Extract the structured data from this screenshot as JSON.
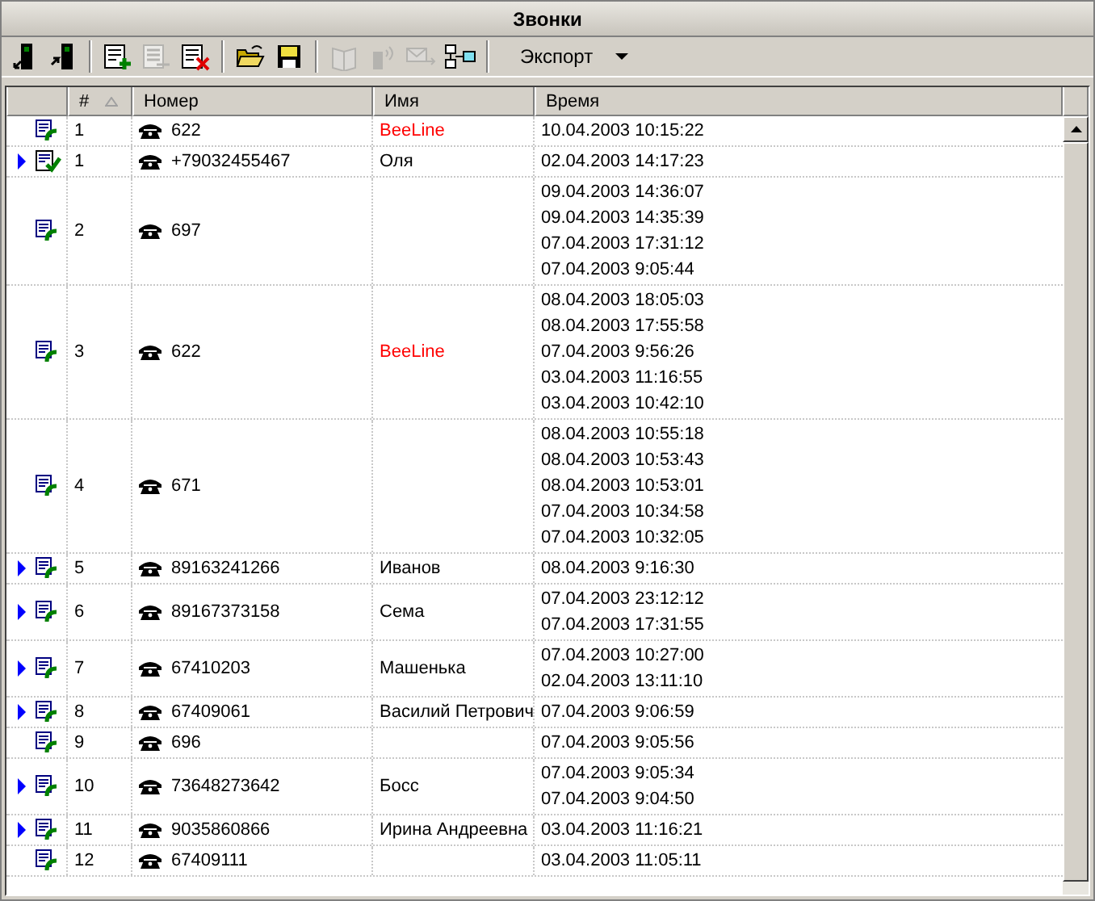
{
  "window": {
    "title": "Звонки"
  },
  "toolbar": [
    {
      "kind": "phone-in",
      "disabled": false
    },
    {
      "kind": "phone-out",
      "disabled": false
    },
    {
      "kind": "sep"
    },
    {
      "kind": "add",
      "disabled": false
    },
    {
      "kind": "edit",
      "disabled": true
    },
    {
      "kind": "delete",
      "disabled": false
    },
    {
      "kind": "sep"
    },
    {
      "kind": "open",
      "disabled": false
    },
    {
      "kind": "save",
      "disabled": false
    },
    {
      "kind": "sep"
    },
    {
      "kind": "book",
      "disabled": true
    },
    {
      "kind": "signal",
      "disabled": true
    },
    {
      "kind": "sms",
      "disabled": true
    },
    {
      "kind": "network",
      "disabled": false
    },
    {
      "kind": "sep"
    },
    {
      "kind": "dropdown",
      "label": "Экспорт"
    }
  ],
  "table": {
    "columns": [
      {
        "label": "#",
        "sort_ascending": true
      },
      {
        "label": "Номер"
      },
      {
        "label": "Имя"
      },
      {
        "label": "Время"
      }
    ],
    "rows": [
      {
        "arrow": false,
        "kind": "call",
        "num": "1",
        "phone": "622",
        "name": "BeeLine",
        "color": "#ff0000",
        "times": [
          "10.04.2003 10:15:22"
        ]
      },
      {
        "arrow": true,
        "kind": "checked",
        "num": "1",
        "phone": "+79032455467",
        "name": "Оля",
        "times": [
          "02.04.2003 14:17:23"
        ]
      },
      {
        "arrow": false,
        "kind": "call",
        "num": "2",
        "phone": "697",
        "times": [
          "09.04.2003 14:36:07",
          "09.04.2003 14:35:39",
          "07.04.2003 17:31:12",
          "07.04.2003 9:05:44"
        ]
      },
      {
        "arrow": false,
        "kind": "call",
        "num": "3",
        "phone": "622",
        "name": "BeeLine",
        "color": "#ff0000",
        "times": [
          "08.04.2003 18:05:03",
          "08.04.2003 17:55:58",
          "07.04.2003 9:56:26",
          "03.04.2003 11:16:55",
          "03.04.2003 10:42:10"
        ]
      },
      {
        "arrow": false,
        "kind": "call",
        "num": "4",
        "phone": "671",
        "times": [
          "08.04.2003 10:55:18",
          "08.04.2003 10:53:43",
          "08.04.2003 10:53:01",
          "07.04.2003 10:34:58",
          "07.04.2003 10:32:05"
        ]
      },
      {
        "arrow": true,
        "kind": "call",
        "num": "5",
        "phone": "89163241266",
        "name": "Иванов",
        "times": [
          "08.04.2003 9:16:30"
        ]
      },
      {
        "arrow": true,
        "kind": "call",
        "num": "6",
        "phone": "89167373158",
        "name": "Сема",
        "times": [
          "07.04.2003 23:12:12",
          "07.04.2003 17:31:55"
        ]
      },
      {
        "arrow": true,
        "kind": "call",
        "num": "7",
        "phone": "67410203",
        "name": "Машенька",
        "times": [
          "07.04.2003 10:27:00",
          "02.04.2003 13:11:10"
        ]
      },
      {
        "arrow": true,
        "kind": "call",
        "num": "8",
        "phone": "67409061",
        "name": "Василий Петрович",
        "times": [
          "07.04.2003 9:06:59"
        ]
      },
      {
        "arrow": false,
        "kind": "call",
        "num": "9",
        "phone": "696",
        "times": [
          "07.04.2003 9:05:56"
        ]
      },
      {
        "arrow": true,
        "kind": "call",
        "num": "10",
        "phone": "73648273642",
        "name": "Босс",
        "times": [
          "07.04.2003 9:05:34",
          "07.04.2003 9:04:50"
        ]
      },
      {
        "arrow": true,
        "kind": "call",
        "num": "11",
        "phone": "9035860866",
        "name": "Ирина Андреевна",
        "times": [
          "03.04.2003 11:16:21"
        ]
      },
      {
        "arrow": false,
        "kind": "call",
        "num": "12",
        "phone": "67409111",
        "times": [
          "03.04.2003 11:05:11"
        ]
      }
    ]
  }
}
